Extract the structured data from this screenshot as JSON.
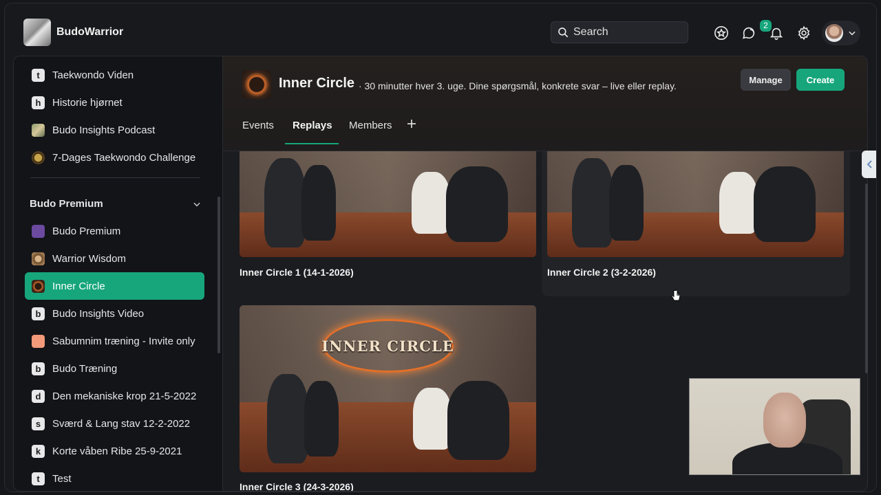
{
  "app": {
    "brand": "BudoWarrior"
  },
  "search": {
    "placeholder": "Search"
  },
  "topbar": {
    "notification_badge": "2"
  },
  "sidebar": {
    "items_top": [
      {
        "icon_letter": "t",
        "label": "Taekwondo Viden"
      },
      {
        "icon_letter": "h",
        "label": "Historie hjørnet"
      },
      {
        "icon_letter": "",
        "label": "Budo Insights Podcast"
      },
      {
        "icon_letter": "",
        "label": "7-Dages Taekwondo Challenge"
      }
    ],
    "section_title": "Budo Premium",
    "items_section": [
      {
        "icon_letter": "",
        "label": "Budo Premium"
      },
      {
        "icon_letter": "",
        "label": "Warrior Wisdom"
      },
      {
        "icon_letter": "",
        "label": "Inner Circle",
        "active": true
      },
      {
        "icon_letter": "b",
        "label": "Budo Insights Video"
      },
      {
        "icon_letter": "",
        "label": "Sabumnim træning - Invite only"
      },
      {
        "icon_letter": "b",
        "label": "Budo Træning"
      },
      {
        "icon_letter": "d",
        "label": "Den mekaniske krop 21-5-2022"
      },
      {
        "icon_letter": "s",
        "label": "Sværd & Lang stav 12-2-2022"
      },
      {
        "icon_letter": "k",
        "label": "Korte våben Ribe 25-9-2021"
      },
      {
        "icon_letter": "t",
        "label": "Test"
      }
    ]
  },
  "group": {
    "title": "Inner Circle",
    "subtitle": "· 30 minutter hver 3. uge. Dine spørgsmål, konkrete svar – live eller replay.",
    "manage_label": "Manage",
    "create_label": "Create",
    "tabs": [
      {
        "label": "Events"
      },
      {
        "label": "Replays",
        "active": true
      },
      {
        "label": "Members"
      }
    ]
  },
  "replays": [
    {
      "title": "Inner Circle 1 (14-1-2026)"
    },
    {
      "title": "Inner Circle 2 (3-2-2026)"
    },
    {
      "title": "Inner Circle 3 (24-3-2026)",
      "thumb_text": "INNER CIRCLE"
    }
  ],
  "colors": {
    "accent": "#17a67c",
    "background": "#18191d",
    "sidebar_bg": "#131418"
  }
}
